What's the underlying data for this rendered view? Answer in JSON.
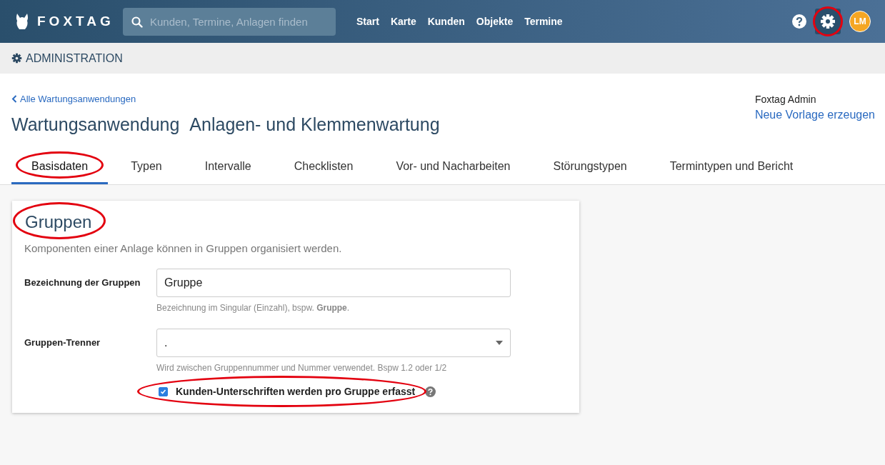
{
  "header": {
    "logo": "FOXTAG",
    "search": {
      "placeholder": "Kunden, Termine, Anlagen finden"
    },
    "nav": [
      "Start",
      "Karte",
      "Kunden",
      "Objekte",
      "Termine"
    ],
    "settings_annotated": true,
    "avatar": "LM"
  },
  "admin_bar": {
    "title": "ADMINISTRATION"
  },
  "back_link": "Alle Wartungsanwendungen",
  "title": {
    "label": "Wartungsanwendung",
    "name": "Anlagen- und Klemmenwartung"
  },
  "user": {
    "name": "Foxtag Admin",
    "action": "Neue Vorlage erzeugen"
  },
  "tabs": [
    {
      "label": "Basisdaten",
      "selected": true,
      "annotated": true
    },
    {
      "label": "Typen",
      "selected": false,
      "annotated": false
    },
    {
      "label": "Intervalle",
      "selected": false,
      "annotated": false
    },
    {
      "label": "Checklisten",
      "selected": false,
      "annotated": false
    },
    {
      "label": "Vor- und Nacharbeiten",
      "selected": false,
      "annotated": false
    },
    {
      "label": "Störungstypen",
      "selected": false,
      "annotated": false
    },
    {
      "label": "Termintypen und Bericht",
      "selected": false,
      "annotated": false
    }
  ],
  "section": {
    "title": "Gruppen",
    "title_annotated": true,
    "description": "Komponenten einer Anlage können in Gruppen organisiert werden.",
    "fields": [
      {
        "kind": "text",
        "label": "Bezeichnung der Gruppen",
        "value": "Gruppe",
        "help": "Bezeichnung im Singular (Einzahl), bspw. **Gruppe**."
      },
      {
        "kind": "select",
        "label": "Gruppen-Trenner",
        "value": ".",
        "help": "Wird zwischen Gruppennummer und Nummer verwendet. Bspw 1.2 oder 1/2"
      }
    ],
    "checkbox": {
      "label": "Kunden-Unterschriften werden pro Gruppe erfasst",
      "checked": true,
      "annotated": true
    }
  }
}
